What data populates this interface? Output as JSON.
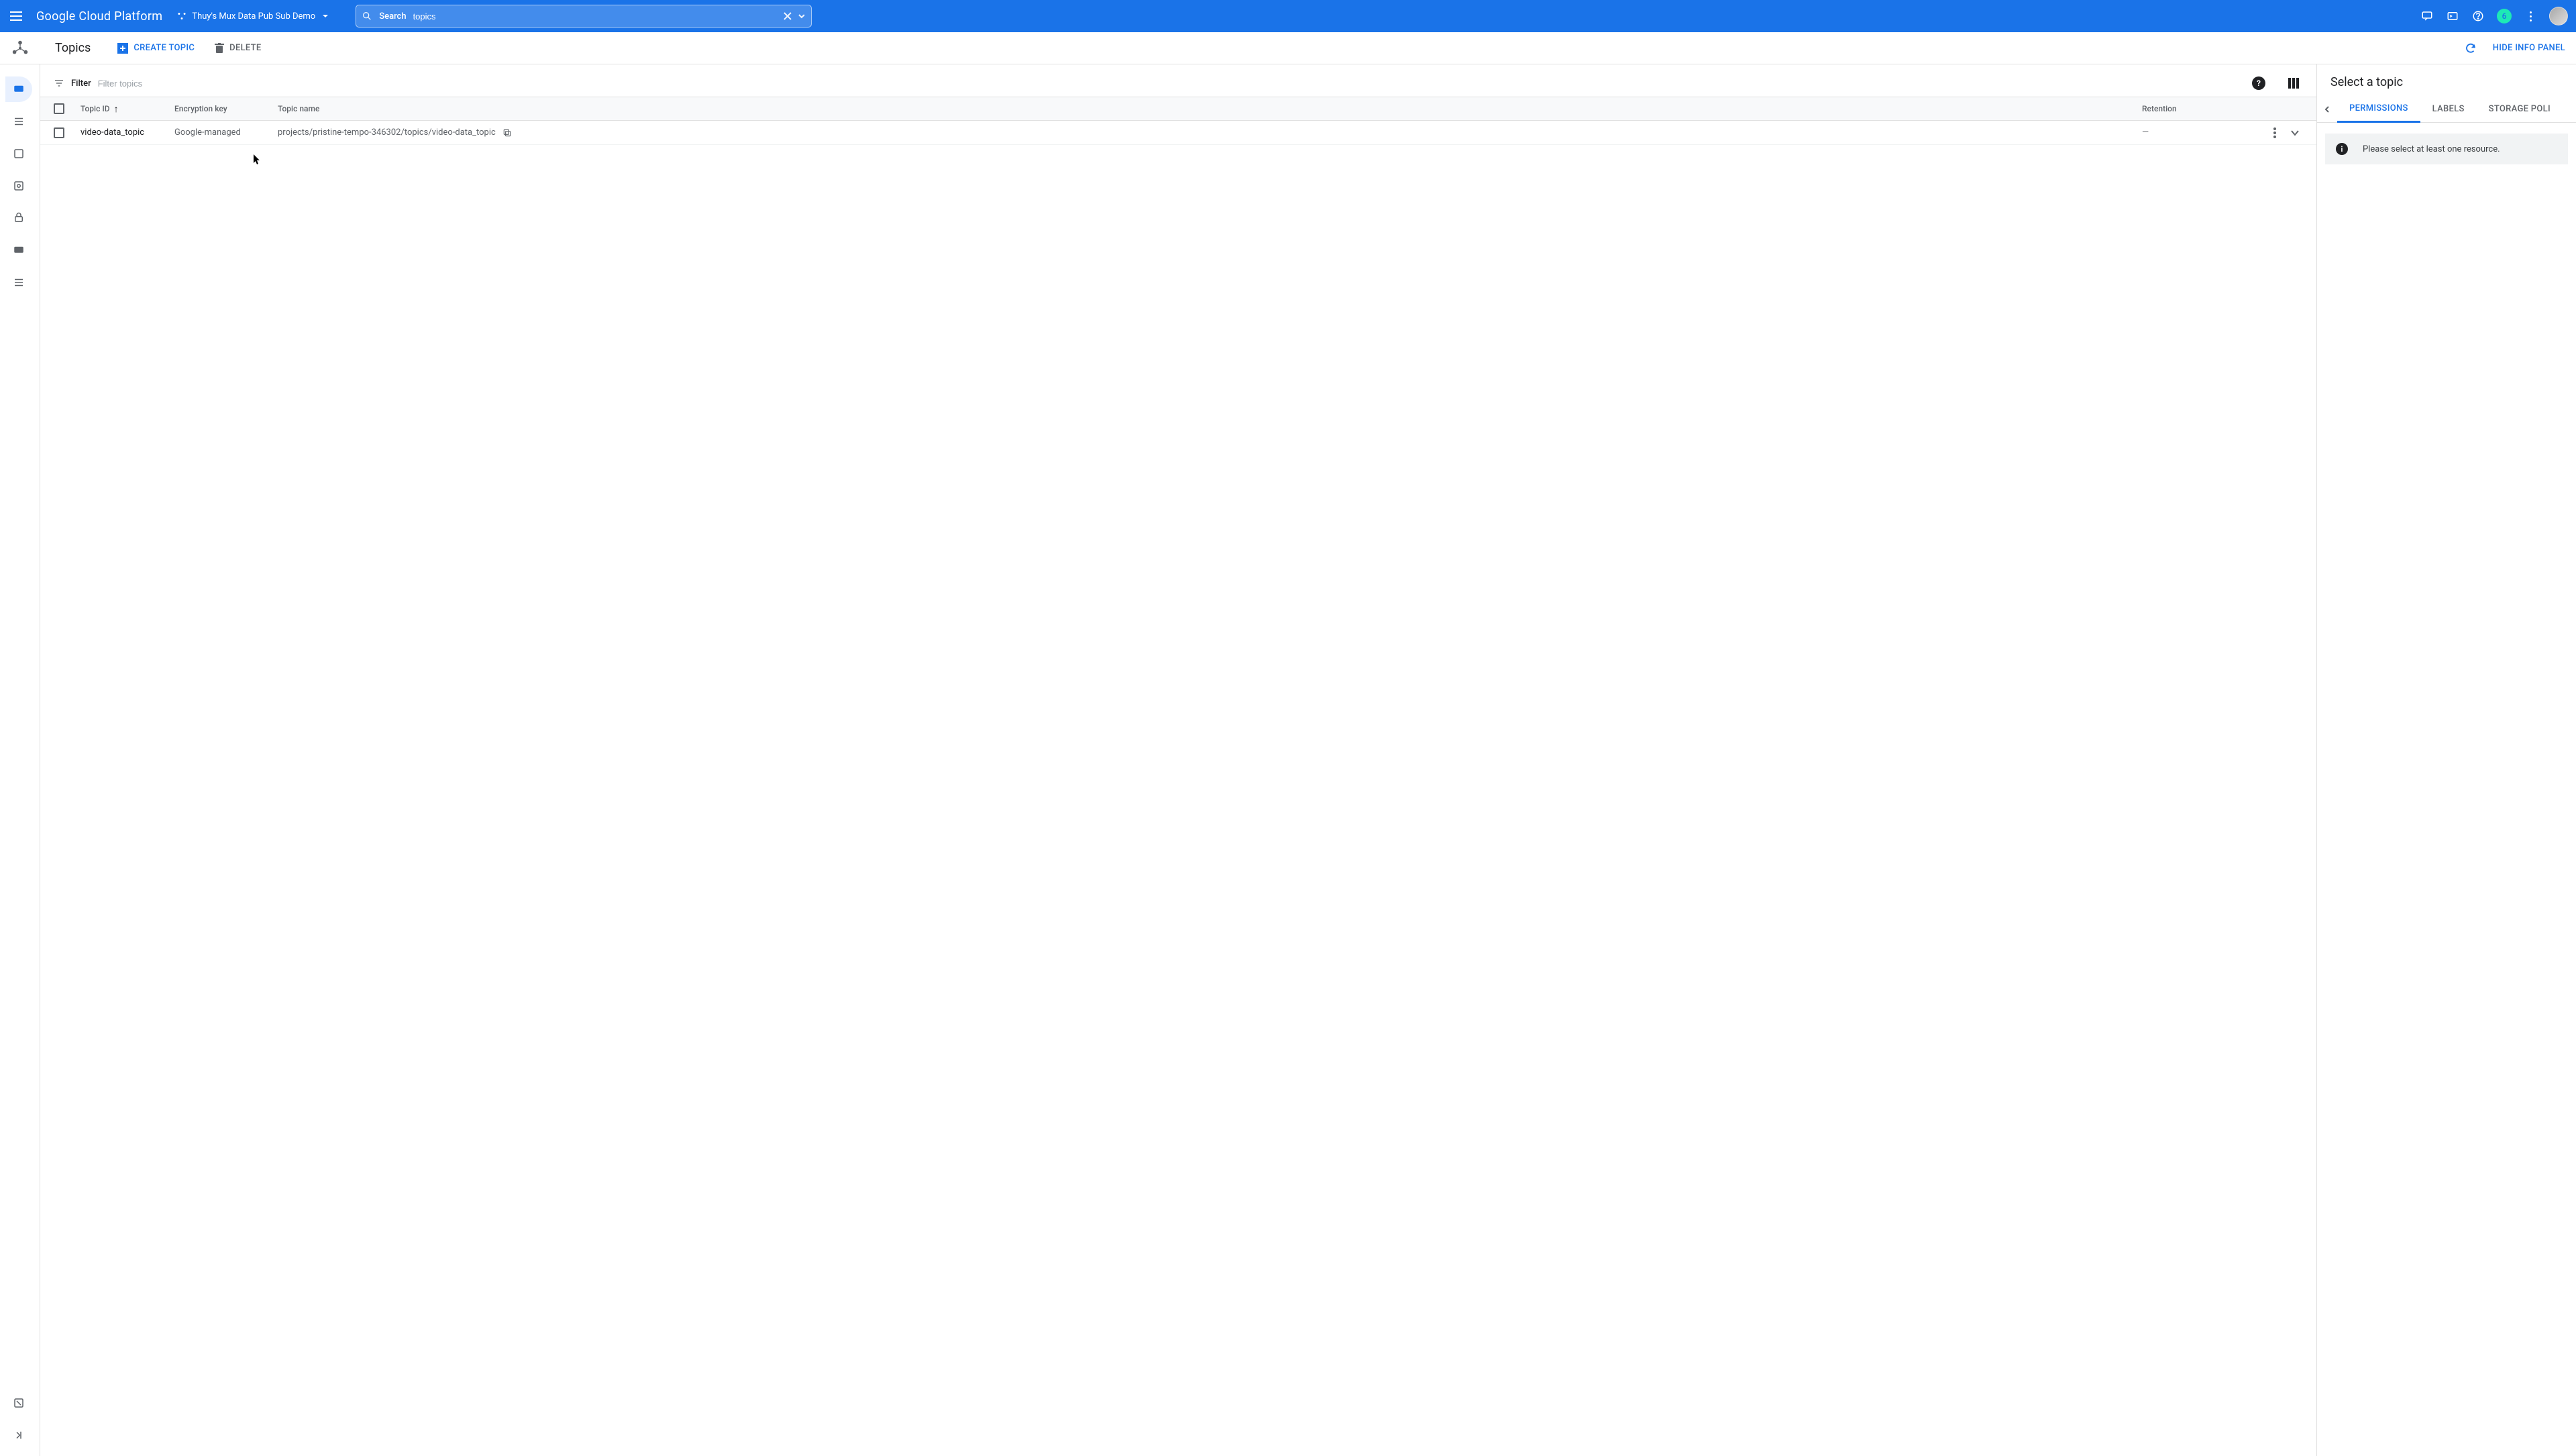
{
  "header": {
    "platform": "Google Cloud Platform",
    "project_name": "Thuy's Mux Data Pub Sub Demo",
    "search_label": "Search",
    "search_value": "topics",
    "notification_count": "6"
  },
  "subheader": {
    "page_title": "Topics",
    "create_label": "CREATE TOPIC",
    "delete_label": "DELETE",
    "hide_panel_label": "HIDE INFO PANEL"
  },
  "filter": {
    "label": "Filter",
    "placeholder": "Filter topics"
  },
  "table": {
    "columns": {
      "topic_id": "Topic ID",
      "encryption": "Encryption key",
      "topic_name": "Topic name",
      "retention": "Retention"
    },
    "rows": [
      {
        "topic_id": "video-data_topic",
        "encryption": "Google-managed",
        "topic_name": "projects/pristine-tempo-346302/topics/video-data_topic",
        "retention": "—"
      }
    ]
  },
  "info_panel": {
    "title": "Select a topic",
    "tabs": {
      "permissions": "PERMISSIONS",
      "labels": "LABELS",
      "storage": "STORAGE POLI"
    },
    "message": "Please select at least one resource."
  },
  "left_nav": {
    "items": [
      "topics",
      "subscriptions",
      "snapshots",
      "schemas",
      "lite-reservations",
      "lite-topics",
      "lite-subscriptions"
    ]
  }
}
